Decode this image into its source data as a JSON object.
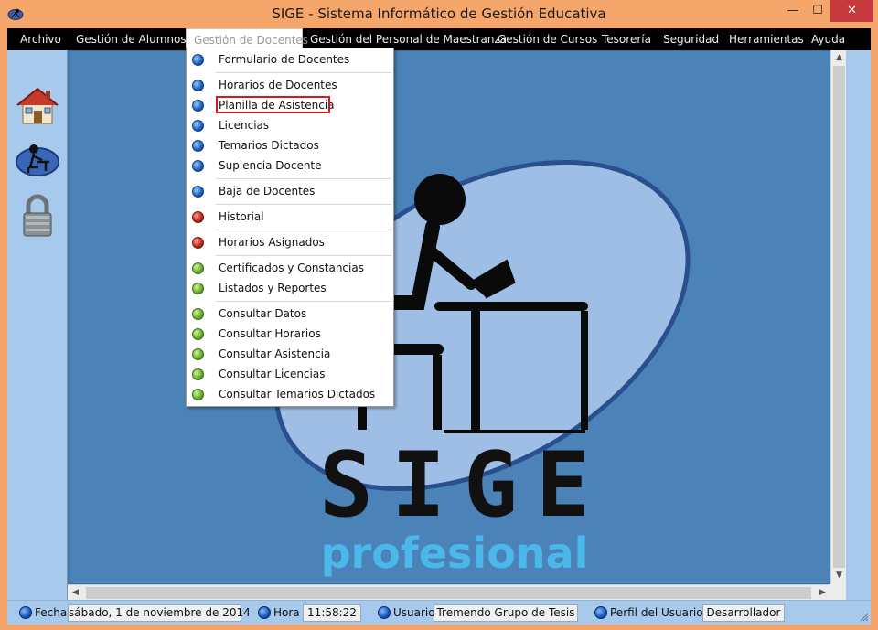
{
  "window": {
    "title": "SIGE - Sistema Informático de Gestión Educativa",
    "minimize_glyph": "—",
    "maximize_glyph": "☐",
    "close_glyph": "✕"
  },
  "menubar": {
    "items": [
      {
        "label": "Archivo"
      },
      {
        "label": "Gestión de  Alumnos"
      },
      {
        "label": "Gestión de Docentes"
      },
      {
        "label": "Gestión del Personal de Maestranza"
      },
      {
        "label": "Gestión de Cursos"
      },
      {
        "label": "Tesorería"
      },
      {
        "label": "Seguridad"
      },
      {
        "label": "Herramientas"
      },
      {
        "label": "Ayuda"
      }
    ]
  },
  "sidebar": {
    "icons": [
      "home-icon",
      "teacher-desk-icon",
      "padlock-icon"
    ]
  },
  "dropdown": {
    "items": [
      {
        "label": "Formulario de Docentes",
        "color": "blue"
      },
      {
        "label": "Horarios de Docentes",
        "color": "blue"
      },
      {
        "label": "Planilla de Asistencia",
        "color": "blue",
        "highlighted": true
      },
      {
        "label": "Licencias",
        "color": "blue"
      },
      {
        "label": "Temarios Dictados",
        "color": "blue"
      },
      {
        "label": "Suplencia Docente",
        "color": "blue"
      },
      {
        "label": "Baja de Docentes",
        "color": "blue"
      },
      {
        "label": "Historial",
        "color": "red"
      },
      {
        "label": "Horarios Asignados",
        "color": "red"
      },
      {
        "label": "Certificados y Constancias",
        "color": "green"
      },
      {
        "label": "Listados y Reportes",
        "color": "green"
      },
      {
        "label": "Consultar Datos",
        "color": "green"
      },
      {
        "label": "Consultar Horarios",
        "color": "green"
      },
      {
        "label": "Consultar Asistencia",
        "color": "green"
      },
      {
        "label": "Consultar Licencias",
        "color": "green"
      },
      {
        "label": "Consultar Temarios Dictados",
        "color": "green"
      }
    ]
  },
  "logo": {
    "wordmark": "SIGE",
    "tagline": "profesional"
  },
  "statusbar": {
    "fecha_label": "Fecha",
    "fecha_value": "sábado, 1 de noviembre de 2014",
    "hora_label": "Hora",
    "hora_value": "11:58:22",
    "usuario_label": "Usuario",
    "usuario_value": "Tremendo Grupo de Tesis",
    "perfil_label": "Perfil del Usuario",
    "perfil_value": "Desarrollador"
  },
  "colors": {
    "titlebar": "#f4a66b",
    "close_button": "#c7383c",
    "menubar": "#000000",
    "client_background": "#4b83b9",
    "side_panels": "#a6c9ec",
    "highlight_box": "#d11b1b"
  }
}
